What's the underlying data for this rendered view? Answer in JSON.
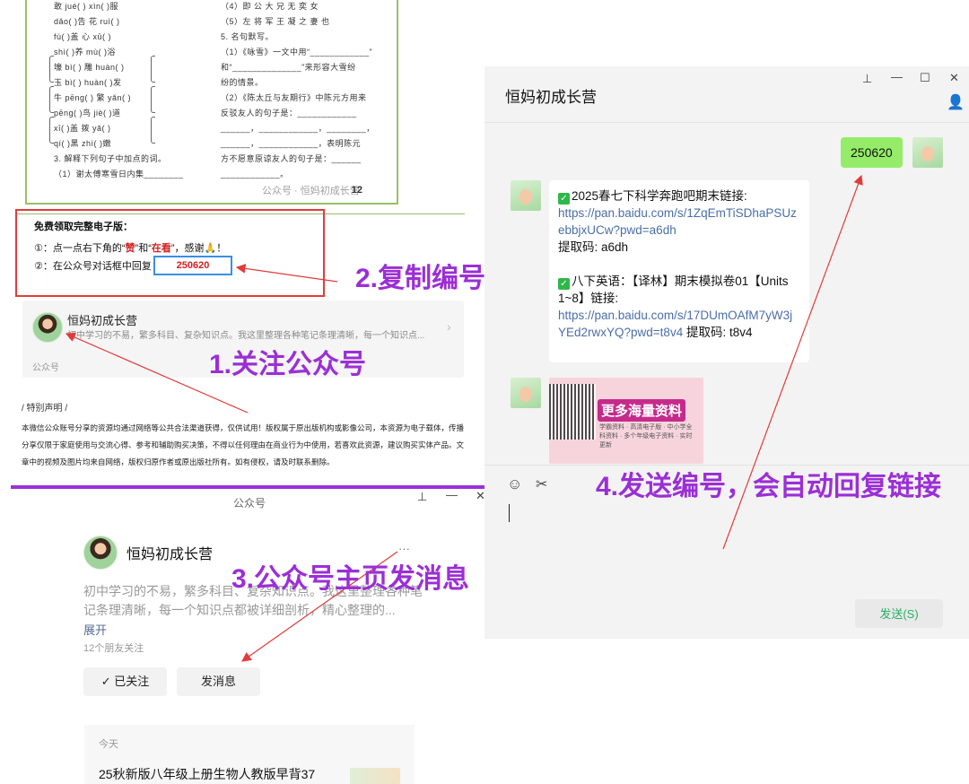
{
  "worksheet": {
    "left_lines": [
      "敢 jué(      )         xìn(      )服",
      "dǎo(      )告         花 ruì(      )",
      "fú(      )盖          心 xū(      )",
      "shì(      )养         mù(      )浴",
      "壕 bì(      )        雕 huàn(      )",
      "玉 bì(      )        huàn(      )发",
      "牛 pēng(      )      繁 yǎn(      )",
      "pēng(      )鸟       jiè(      )道",
      "xī(      )盖          拨 yǎ(      )",
      "qí(      )黑          zhì(      )嫩",
      "3. 解释下列句子中加点的词。",
      "（1）谢太傅寒雪日内集________"
    ],
    "right_lines": [
      "（4）即 公 大 兄 无 奕 女",
      "（5）左 将 军 王 凝 之 妻 也",
      "5. 名句默写。",
      "（1）《咏雪》一文中用“____________”",
      "和“______________”来形容大雪纷",
      "纷的情景。",
      "（2）《陈太丘与友期行》中陈元方用来",
      "反驳友人的句子是：____________",
      "______，____________，________，",
      "______，____________，表明陈元",
      "方不愿意原谅友人的句子是：______",
      "____________。"
    ],
    "page_number": "12",
    "watermark": "公众号 · 恒妈初成长营"
  },
  "instructions": {
    "title": "免费领取完整电子版：",
    "line1_prefix": "①：点一点右下角的“",
    "like": "赞",
    "line1_mid": "”和“",
    "viewing": "在看",
    "line1_suffix": "”，感谢🙏！",
    "line2_prefix": "②：在公众号对话框中回复：",
    "code": "250620"
  },
  "account_card": {
    "name": "恒妈初成长营",
    "description": "初中学习的不易，繁多科目、复杂知识点。我这里整理各种笔记条理清晰，每一个知识点...",
    "footer": "公众号"
  },
  "declaration": {
    "title": "/ 特别声明 /",
    "text": "本微信公众账号分享的资源均通过网络等公共合法渠道获得，仅供试用！版权属于原出版机构或影像公司，本资源为电子载体，传播分享仅限于家庭使用与交流心得、参考和辅助购买决策，不得以任何理由在商业行为中使用，若喜欢此资源，建议购买实体产品。文章中的视频及图片均来自网络，版权归原作者或原出版社所有。如有侵权，请及时联系删除。"
  },
  "annotations": {
    "step1": "1.关注公众号",
    "step2": "2.复制编号",
    "step3": "3.公众号主页发消息",
    "step4": "4.发送编号，会自动回复链接"
  },
  "chat": {
    "title": "恒妈初成长营",
    "sent_message": "250620",
    "reply": {
      "item1_title": "2025春七下科学奔跑吧期末链接:",
      "item1_link": "https://pan.baidu.com/s/1ZqEmTiSDhaPSUzebbjxUCw?pwd=a6dh",
      "item1_code": "提取码: a6dh",
      "item2_title": "八下英语：【译林】期末模拟卷01【Units 1~8】链接:",
      "item2_link": "https://pan.baidu.com/s/17DUmOAfM7yW3jYEd2rwxYQ?pwd=t8v4",
      "item2_code": "提取码: t8v4"
    },
    "image_title": "更多海量资料",
    "image_sub": "学霸资料 · 高清电子版 · 中小学全科资料 · 多个年级电子资料 · 实时更新",
    "send_label": "发送(S)"
  },
  "official_account": {
    "header": "公众号",
    "name": "恒妈初成长营",
    "description": "初中学习的不易，繁多科目、复杂知识点。我这里整理各种笔记条理清晰，每一个知识点都被详细剖析，精心整理的...",
    "expand": "展开",
    "friends": "12个朋友关注",
    "followed_label": "已关注",
    "message_label": "发消息",
    "today": "今天",
    "article": "25秋新版八年级上册生物人教版早背37"
  },
  "colors": {
    "annotation": "#9b2fd6",
    "red_box": "#e23b3b",
    "wechat_green": "#95ec69",
    "link": "#4b6ea8"
  }
}
